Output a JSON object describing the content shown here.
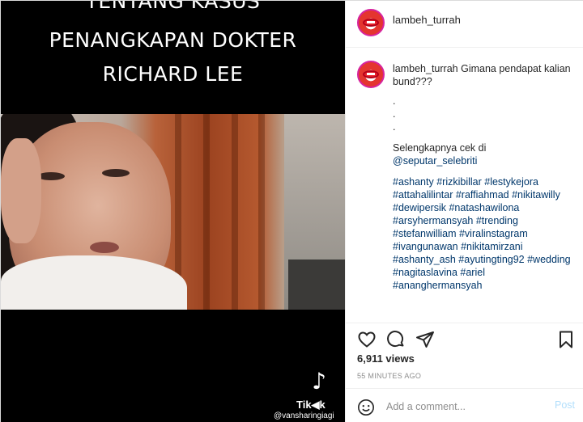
{
  "media": {
    "caption_lines": [
      "TENTANG KASUS",
      "PENANGKAPAN DOKTER",
      "RICHARD LEE"
    ],
    "tiktok_word": "Tik◀k",
    "tiktok_handle": "@vansharingiagi"
  },
  "header": {
    "username": "lambeh_turrah"
  },
  "post": {
    "author": "lambeh_turrah",
    "text": "Gimana pendapat kalian bund???",
    "dots": [
      ".",
      ".",
      "."
    ],
    "more_text": "Selengkapnya cek di",
    "mention": "@seputar_selebriti",
    "hashtags": "#ashanty #rizkibillar #lestykejora #attahalilintar #raffiahmad #nikitawilly #dewipersik #natashawilona #arsyhermansyah #trending #stefanwilliam #viralinstagram #ivangunawan #nikitamirzani #ashanty_ash #ayutingting92 #wedding #nagitaslavina #ariel #ananghermansyah"
  },
  "actions": {
    "views": "6,911 views",
    "time": "55 MINUTES AGO",
    "add_comment_placeholder": "Add a comment...",
    "post_label": "Post"
  },
  "icons": [
    "heart-icon",
    "comment-icon",
    "share-icon",
    "bookmark-icon",
    "emoji-icon",
    "tiktok-icon"
  ],
  "colors": {
    "link": "#00376b",
    "post_disabled": "#b2dffc",
    "muted": "#8e8e8e"
  }
}
